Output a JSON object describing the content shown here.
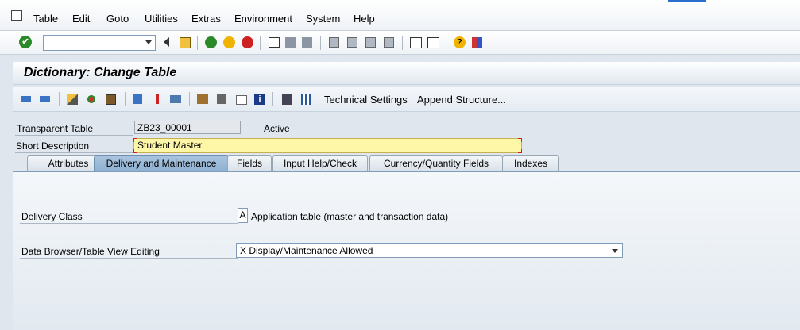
{
  "menu": {
    "items": [
      {
        "label": "Table"
      },
      {
        "label": "Edit"
      },
      {
        "label": "Goto"
      },
      {
        "label": "Utilities"
      },
      {
        "label": "Extras"
      },
      {
        "label": "Environment"
      },
      {
        "label": "System"
      },
      {
        "label": "Help"
      }
    ]
  },
  "command_field": {
    "value": ""
  },
  "title": "Dictionary: Change Table",
  "app_toolbar": {
    "technical_settings": "Technical Settings",
    "append_structure": "Append Structure..."
  },
  "header": {
    "transparent_table_label": "Transparent Table",
    "table_name": "ZB23_00001",
    "status": "Active",
    "short_description_label": "Short Description",
    "short_description": "Student Master"
  },
  "tabs": [
    {
      "label": "Attributes",
      "active": false
    },
    {
      "label": "Delivery and Maintenance",
      "active": true
    },
    {
      "label": "Fields",
      "active": false
    },
    {
      "label": "Input Help/Check",
      "active": false
    },
    {
      "label": "Currency/Quantity Fields",
      "active": false
    },
    {
      "label": "Indexes",
      "active": false
    }
  ],
  "delivery": {
    "delivery_class_label": "Delivery Class",
    "delivery_class_value": "A",
    "delivery_class_text": "Application table (master and transaction data)",
    "browser_label": "Data Browser/Table View Editing",
    "browser_value": "X Display/Maintenance Allowed"
  },
  "colors": {
    "accent": "#2a6fd0",
    "active_tab": "#8fb0d2",
    "edit_field": "#fff7a8"
  }
}
